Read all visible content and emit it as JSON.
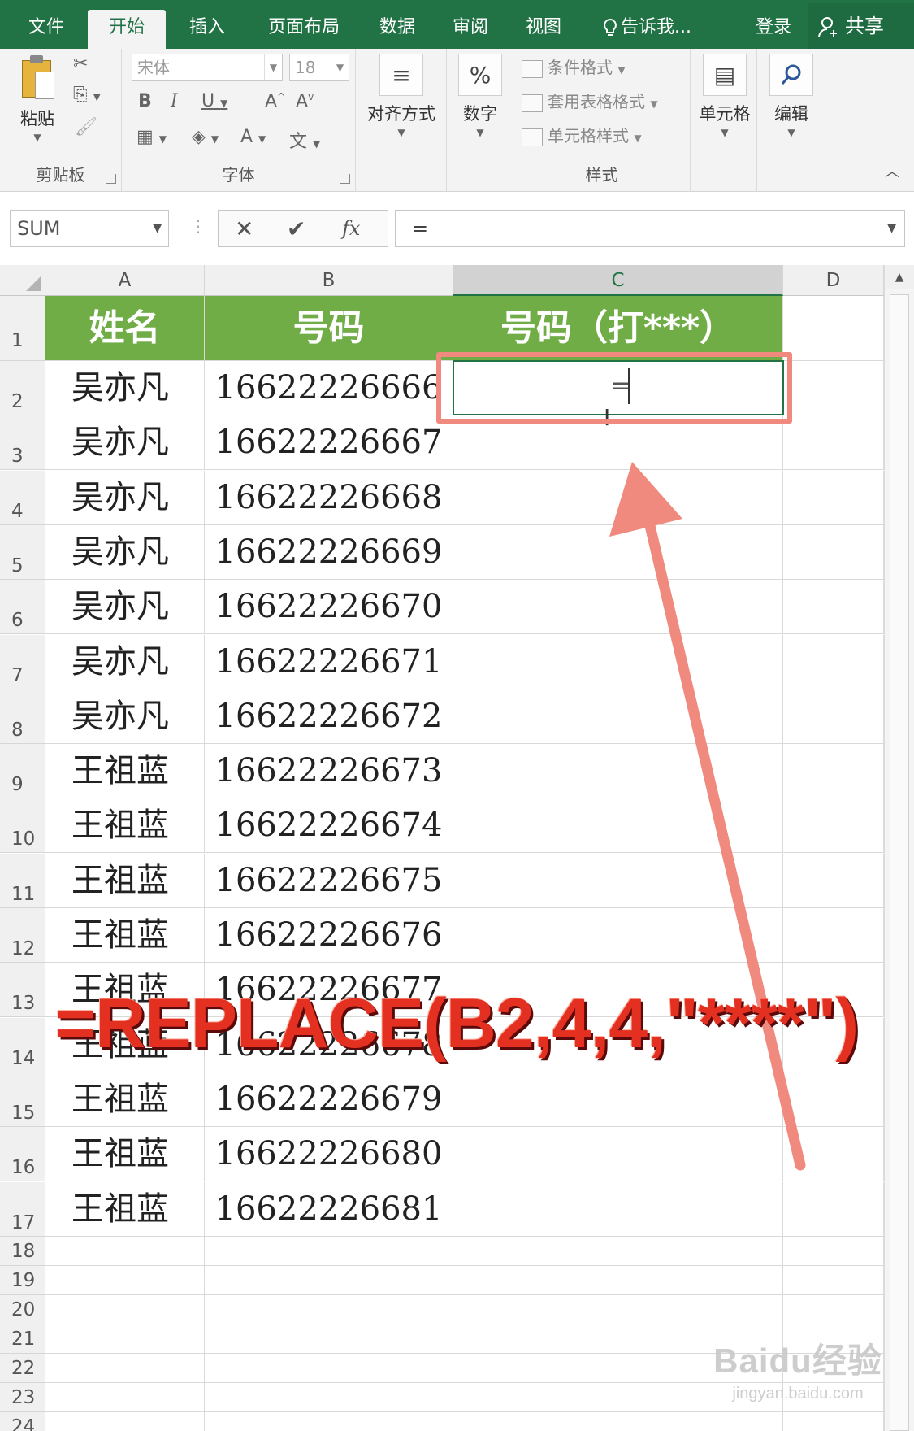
{
  "tabs": [
    {
      "label": "文件",
      "active": false
    },
    {
      "label": "开始",
      "active": true
    },
    {
      "label": "插入",
      "active": false
    },
    {
      "label": "页面布局",
      "active": false
    },
    {
      "label": "数据",
      "active": false
    },
    {
      "label": "审阅",
      "active": false
    },
    {
      "label": "视图",
      "active": false
    }
  ],
  "tell_me": "告诉我...",
  "login": "登录",
  "share": "共享",
  "ribbon": {
    "clipboard": {
      "paste": "粘贴",
      "group": "剪贴板"
    },
    "font": {
      "name": "宋体",
      "size": "18",
      "group": "字体"
    },
    "align": {
      "label": "对齐方式"
    },
    "number": {
      "label": "数字"
    },
    "styles": {
      "cond": "条件格式",
      "table": "套用表格格式",
      "cell": "单元格样式",
      "group": "样式"
    },
    "cells": {
      "label": "单元格"
    },
    "edit": {
      "label": "编辑"
    }
  },
  "formula_bar": {
    "name_box": "SUM",
    "content": "="
  },
  "columns": [
    "A",
    "B",
    "C",
    "D"
  ],
  "selected_column": "C",
  "header_row": [
    "姓名",
    "号码",
    "号码（打***）"
  ],
  "rows": [
    {
      "num": "2",
      "name": "吴亦凡",
      "phone": "16622226666"
    },
    {
      "num": "3",
      "name": "吴亦凡",
      "phone": "16622226667"
    },
    {
      "num": "4",
      "name": "吴亦凡",
      "phone": "16622226668"
    },
    {
      "num": "5",
      "name": "吴亦凡",
      "phone": "16622226669"
    },
    {
      "num": "6",
      "name": "吴亦凡",
      "phone": "16622226670"
    },
    {
      "num": "7",
      "name": "吴亦凡",
      "phone": "16622226671"
    },
    {
      "num": "8",
      "name": "吴亦凡",
      "phone": "16622226672"
    },
    {
      "num": "9",
      "name": "王祖蓝",
      "phone": "16622226673"
    },
    {
      "num": "10",
      "name": "王祖蓝",
      "phone": "16622226674"
    },
    {
      "num": "11",
      "name": "王祖蓝",
      "phone": "16622226675"
    },
    {
      "num": "12",
      "name": "王祖蓝",
      "phone": "16622226676"
    },
    {
      "num": "13",
      "name": "王祖蓝",
      "phone": "16622226677"
    },
    {
      "num": "14",
      "name": "王祖蓝",
      "phone": "16622226678"
    },
    {
      "num": "15",
      "name": "王祖蓝",
      "phone": "16622226679"
    },
    {
      "num": "16",
      "name": "王祖蓝",
      "phone": "16622226680"
    },
    {
      "num": "17",
      "name": "王祖蓝",
      "phone": "16622226681"
    }
  ],
  "empty_rows": [
    "18",
    "19",
    "20",
    "21",
    "22",
    "23",
    "24"
  ],
  "active_cell_value": "=",
  "overlay_formula": "=REPLACE(B2,4,4,\"****\")",
  "watermark": {
    "line1": "Baidu经验",
    "line2": "jingyan.baidu.com"
  },
  "colors": {
    "excel_green": "#217346",
    "header_fill": "#70ad47",
    "highlight": "#f08a7e",
    "formula_red": "#e43020"
  }
}
